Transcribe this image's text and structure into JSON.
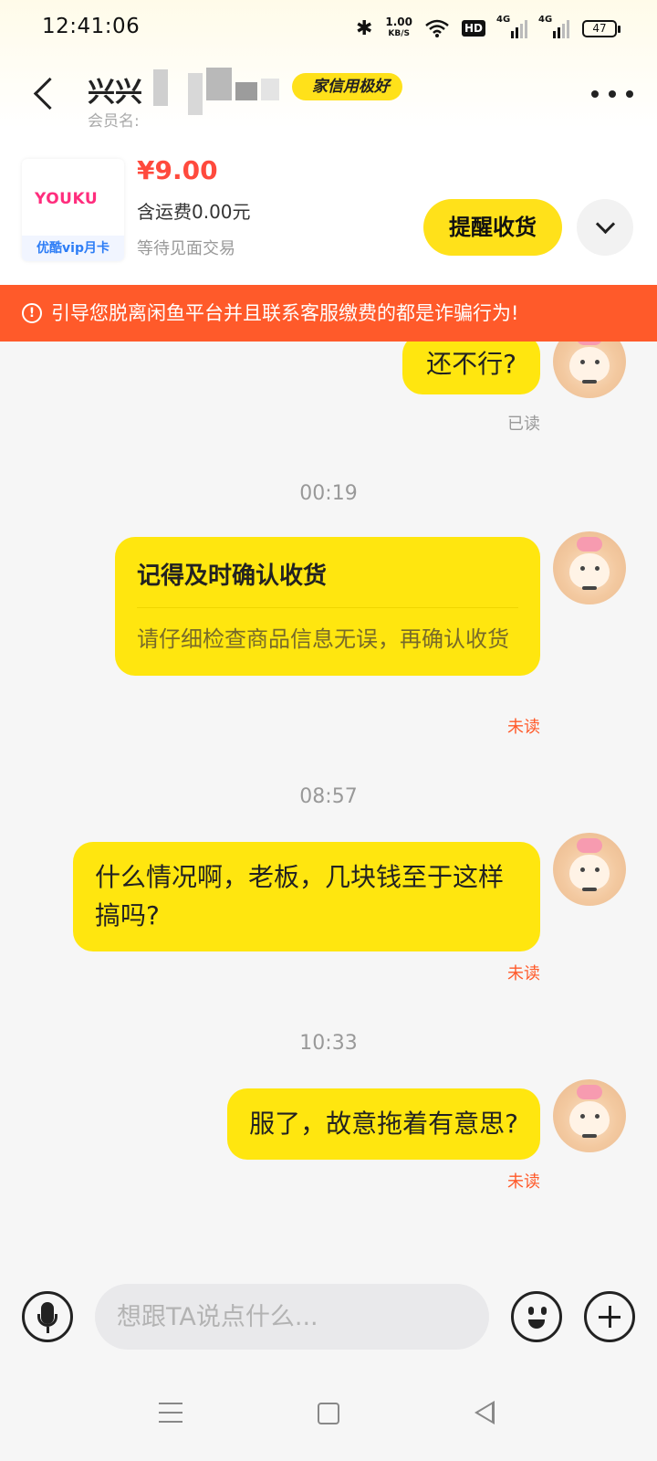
{
  "status_bar": {
    "time": "12:41:06",
    "net_speed_value": "1.00",
    "net_speed_unit": "KB/S",
    "hd_label": "HD",
    "signal1_label": "4G",
    "signal2_label": "4G",
    "battery_level": "47"
  },
  "header": {
    "seller_name": "兴兴",
    "credit_badge": "家信用极好",
    "member_label": "会员名:"
  },
  "product": {
    "brand_logo": "YOUKU",
    "thumb_caption": "优酷vip月卡",
    "price": "¥9.00",
    "shipping": "含运费0.00元",
    "trade_status": "等待见面交易",
    "remind_button": "提醒收货"
  },
  "warning": {
    "text": "引导您脱离闲鱼平台并且联系客服缴费的都是诈骗行为!"
  },
  "messages": [
    {
      "text": "还不行?",
      "status": "已读"
    },
    {
      "time": "00:19",
      "card_title": "记得及时确认收货",
      "card_body": "请仔细检查商品信息无误，再确认收货",
      "status": "未读"
    },
    {
      "time": "08:57",
      "text": "什么情况啊，老板，几块钱至于这样搞吗?",
      "status": "未读"
    },
    {
      "time": "10:33",
      "text": "服了，故意拖着有意思?",
      "status": "未读"
    }
  ],
  "input": {
    "placeholder": "想跟TA说点什么..."
  },
  "colors": {
    "accent_yellow": "#ffe60f",
    "warning_orange": "#ff5a2a",
    "price_red": "#ff4a3d"
  },
  "icons": [
    "back-icon",
    "more-icon",
    "expand-icon",
    "warning-icon",
    "voice-icon",
    "emoji-icon",
    "plus-icon",
    "nav-menu-icon",
    "nav-home-icon",
    "nav-back-icon"
  ]
}
